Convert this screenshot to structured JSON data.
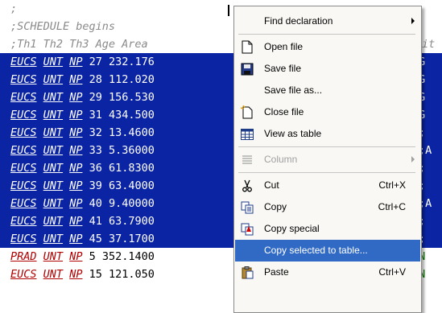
{
  "editor": {
    "comment_lines": [
      ";",
      ";SCHEDULE begins",
      ";Th1 Th2 Th3 Age Area"
    ],
    "header_tail": "it",
    "selected_rows": [
      {
        "c1": "EUCS",
        "c2": "UNT",
        "c3": "NP",
        "age": "27",
        "area": "232.176",
        "tail": "G"
      },
      {
        "c1": "EUCS",
        "c2": "UNT",
        "c3": "NP",
        "age": "28",
        "area": "112.020",
        "tail": "G"
      },
      {
        "c1": "EUCS",
        "c2": "UNT",
        "c3": "NP",
        "age": "29",
        "area": "156.530",
        "tail": "G"
      },
      {
        "c1": "EUCS",
        "c2": "UNT",
        "c3": "NP",
        "age": "31",
        "area": "434.500",
        "tail": "G"
      },
      {
        "c1": "EUCS",
        "c2": "UNT",
        "c3": "NP",
        "age": "32",
        "area": "13.4600",
        "tail": ";"
      },
      {
        "c1": "EUCS",
        "c2": "UNT",
        "c3": "NP",
        "age": "33",
        "area": "5.36000",
        "tail": ";A"
      },
      {
        "c1": "EUCS",
        "c2": "UNT",
        "c3": "NP",
        "age": "36",
        "area": "61.8300",
        "tail": ";"
      },
      {
        "c1": "EUCS",
        "c2": "UNT",
        "c3": "NP",
        "age": "39",
        "area": "63.4000",
        "tail": ";"
      },
      {
        "c1": "EUCS",
        "c2": "UNT",
        "c3": "NP",
        "age": "40",
        "area": "9.40000",
        "tail": ";A"
      },
      {
        "c1": "EUCS",
        "c2": "UNT",
        "c3": "NP",
        "age": "41",
        "area": "63.7900",
        "tail": ";"
      },
      {
        "c1": "EUCS",
        "c2": "UNT",
        "c3": "NP",
        "age": "45",
        "area": "37.1700",
        "tail": ";"
      }
    ],
    "plain_rows": [
      {
        "c1": "PRAD",
        "c2": "UNT",
        "c3": "NP",
        "age": "5",
        "area": "352.1400",
        "tail": "IN"
      },
      {
        "c1": "EUCS",
        "c2": "UNT",
        "c3": "NP",
        "age": "15",
        "area": "121.050",
        "tail": "IN"
      }
    ]
  },
  "context_menu": {
    "items": [
      {
        "label": "Find declaration",
        "submenu": true
      },
      {
        "label": "Open file",
        "icon": "open-file-icon"
      },
      {
        "label": "Save file",
        "icon": "save-file-icon"
      },
      {
        "label": "Save file as..."
      },
      {
        "label": "Close file",
        "icon": "close-file-icon"
      },
      {
        "label": "View as table",
        "icon": "table-icon"
      },
      {
        "label": "Column",
        "icon": "column-icon",
        "submenu": true,
        "disabled": true
      },
      {
        "label": "Cut",
        "shortcut": "Ctrl+X",
        "icon": "scissors-icon"
      },
      {
        "label": "Copy",
        "shortcut": "Ctrl+C",
        "icon": "copy-icon"
      },
      {
        "label": "Copy special",
        "icon": "copy-special-icon"
      },
      {
        "label": "Copy selected to table...",
        "highlighted": true
      },
      {
        "label": "Paste",
        "shortcut": "Ctrl+V",
        "icon": "paste-icon"
      }
    ]
  },
  "colors": {
    "selection": "#0b24a3",
    "menu_highlight": "#316ac5",
    "keyword_red": "#b00000",
    "tail_green": "#0a7d00"
  }
}
